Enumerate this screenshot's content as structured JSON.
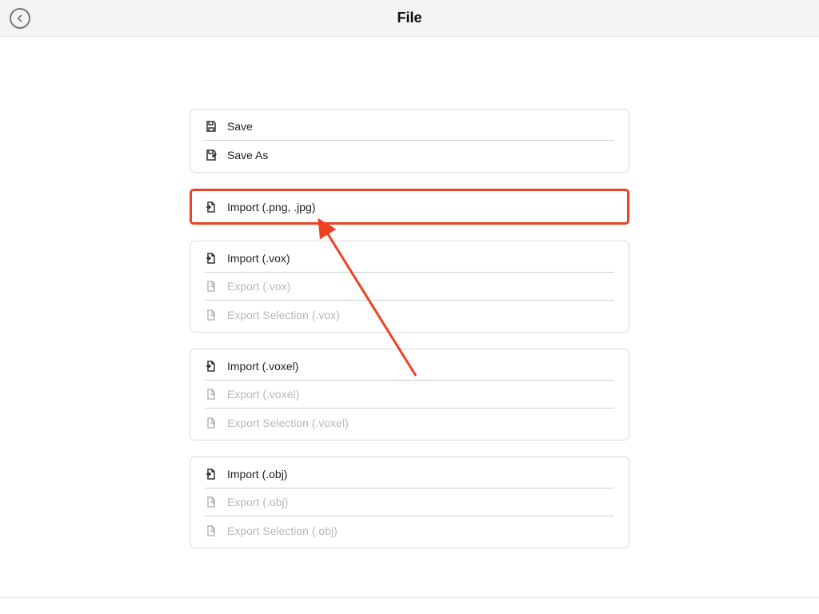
{
  "header": {
    "title": "File"
  },
  "groups": [
    {
      "id": "save-group",
      "highlighted": false,
      "items": [
        {
          "id": "save",
          "label": "Save",
          "icon": "save-icon",
          "disabled": false
        },
        {
          "id": "save-as",
          "label": "Save As",
          "icon": "save-as-icon",
          "disabled": false
        }
      ]
    },
    {
      "id": "import-image-group",
      "highlighted": true,
      "items": [
        {
          "id": "import-image",
          "label": "Import (.png, .jpg)",
          "icon": "import-icon",
          "disabled": false
        }
      ]
    },
    {
      "id": "vox-group",
      "highlighted": false,
      "items": [
        {
          "id": "import-vox",
          "label": "Import (.vox)",
          "icon": "import-icon",
          "disabled": false
        },
        {
          "id": "export-vox",
          "label": "Export (.vox)",
          "icon": "export-icon",
          "disabled": true
        },
        {
          "id": "export-sel-vox",
          "label": "Export Selection (.vox)",
          "icon": "export-icon",
          "disabled": true
        }
      ]
    },
    {
      "id": "voxel-group",
      "highlighted": false,
      "items": [
        {
          "id": "import-voxel",
          "label": "Import (.voxel)",
          "icon": "import-icon",
          "disabled": false
        },
        {
          "id": "export-voxel",
          "label": "Export (.voxel)",
          "icon": "export-icon",
          "disabled": true
        },
        {
          "id": "export-sel-voxel",
          "label": "Export Selection (.voxel)",
          "icon": "export-icon",
          "disabled": true
        }
      ]
    },
    {
      "id": "obj-group",
      "highlighted": false,
      "items": [
        {
          "id": "import-obj",
          "label": "Import (.obj)",
          "icon": "import-icon",
          "disabled": false
        },
        {
          "id": "export-obj",
          "label": "Export (.obj)",
          "icon": "export-icon",
          "disabled": true
        },
        {
          "id": "export-sel-obj",
          "label": "Export Selection (.obj)",
          "icon": "export-icon",
          "disabled": true
        }
      ]
    }
  ],
  "annotation": {
    "type": "arrow",
    "color": "#ef4023"
  }
}
